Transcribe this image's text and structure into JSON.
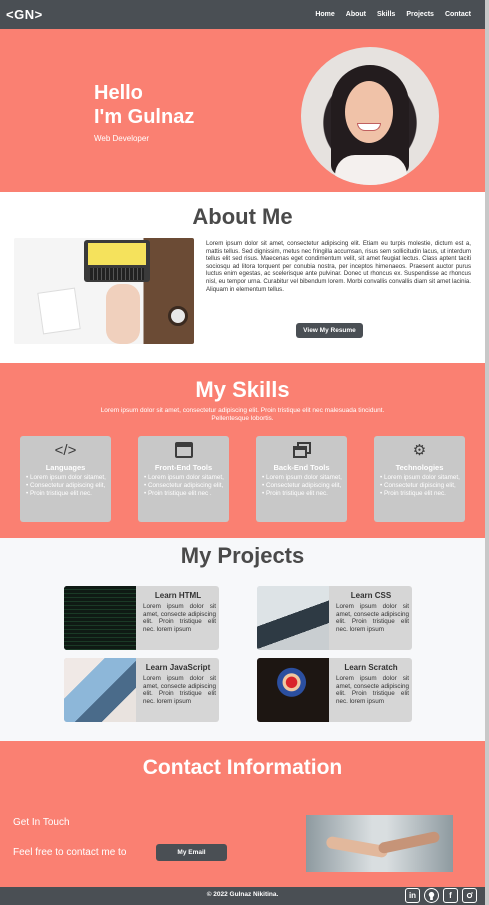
{
  "nav": {
    "logo": "<GN>",
    "links": [
      "Home",
      "About",
      "Skills",
      "Projects",
      "Contact"
    ]
  },
  "hero": {
    "line1": "Hello",
    "line2": "I'm Gulnaz",
    "subtitle": "Web Developer"
  },
  "about": {
    "title": "About Me",
    "text": "Lorem ipsum dolor sit amet, consectetur adipiscing elit. Etiam eu turpis molestie, dictum est a, mattis tellus. Sed dignissim, metus nec fringilla accumsan, risus sem sollicitudin lacus, ut interdum tellus elit sed risus. Maecenas eget condimentum velit, sit amet feugiat lectus. Class aptent taciti sociosqu ad litora torquent per conubia nostra, per inceptos himenaeos. Praesent auctor purus luctus enim egestas, ac scelerisque ante pulvinar. Donec ut rhoncus ex. Suspendisse ac rhoncus nisl, eu tempor urna. Curabitur vel bibendum lorem. Morbi convallis convallis diam sit amet lacinia. Aliquam in elementum tellus.",
    "button": "View My Resume"
  },
  "skills": {
    "title": "My Skills",
    "subtitle": "Lorem ipsum dolor sit amet, consectetur adipiscing elit. Proin tristique elit nec malesuada tincidunt. Pellentesque lobortis.",
    "cards": [
      {
        "icon": "code-icon",
        "title": "Languages",
        "items": [
          "Lorem ipsum dolor sitamet,",
          "Consectetur adipiscing elit,",
          "Proin tristique elit nec."
        ]
      },
      {
        "icon": "window-icon",
        "title": "Front-End Tools",
        "items": [
          "Lorem ipsum dolor sitamet,",
          "Consectetur adipiscing elit,",
          "Proin tristique elit nec ."
        ]
      },
      {
        "icon": "windows-stack-icon",
        "title": "Back-End Tools",
        "items": [
          "Lorem ipsum dolor sitamet,",
          "Consectetur adipiscing elit,",
          "Proin tristique elit nec."
        ]
      },
      {
        "icon": "gear-icon",
        "title": "Technologies",
        "items": [
          "Lorem ipsum dolor sitamet,",
          "Consectetur dipiscing elit,",
          "Proin tristique elit nec."
        ]
      }
    ]
  },
  "projects": {
    "title": "My Projects",
    "items": [
      {
        "title": "Learn HTML",
        "text": "Lorem ipsum dolor sit amet, consecte adipiscing elit. Proin tristique elit nec. lorem ipsum"
      },
      {
        "title": "Learn CSS",
        "text": "Lorem ipsum dolor sit amet, consecte adipiscing elit. Proin tristique elit nec. lorem ipsum"
      },
      {
        "title": "Learn JavaScript",
        "text": "Lorem ipsum dolor sit amet, consecte adipiscing elit. Proin tristique elit nec. lorem ipsum"
      },
      {
        "title": "Learn Scratch",
        "text": "Lorem ipsum dolor sit amet, consecte adipiscing elit. Proin tristique elit nec. lorem ipsum"
      }
    ]
  },
  "contact": {
    "title": "Contact Information",
    "get_in_touch": "Get In Touch",
    "feel_free": "Feel free to contact me to",
    "button": "My Email"
  },
  "footer": {
    "copyright": "© 2022 Gulnaz Nikitina.",
    "socials": [
      "linkedin-icon",
      "github-icon",
      "facebook-icon",
      "instagram-icon"
    ]
  },
  "colors": {
    "salmon": "#fa8072",
    "dark": "#4a4f54",
    "card": "#c8c8c8"
  }
}
